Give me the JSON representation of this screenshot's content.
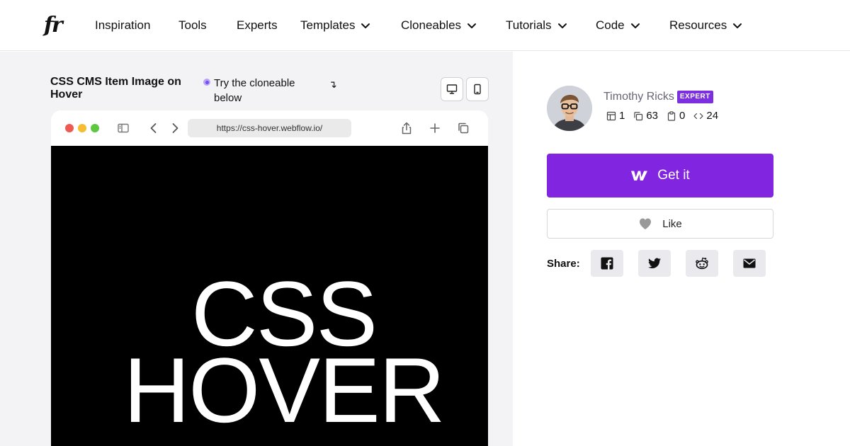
{
  "nav": {
    "logo": "fr",
    "items": [
      {
        "label": "Inspiration",
        "dropdown": false
      },
      {
        "label": "Tools",
        "dropdown": false
      },
      {
        "label": "Experts",
        "dropdown": false
      },
      {
        "label": "Templates",
        "dropdown": true
      },
      {
        "label": "Cloneables",
        "dropdown": true
      },
      {
        "label": "Tutorials",
        "dropdown": true
      },
      {
        "label": "Code",
        "dropdown": true
      },
      {
        "label": "Resources",
        "dropdown": true
      }
    ]
  },
  "preview": {
    "title": "CSS CMS Item Image on Hover",
    "hint": "Try the cloneable below",
    "hint_arrow": "↴",
    "url": "https://css-hover.webflow.io/",
    "hero_text": "CSS\nHOVER"
  },
  "author": {
    "name": "Timothy Ricks",
    "badge": "EXPERT",
    "stats": {
      "pages": "1",
      "clones": "63",
      "copies": "0",
      "embeds": "24"
    }
  },
  "actions": {
    "get_label": "Get it",
    "like_label": "Like",
    "share_label": "Share:"
  },
  "colors": {
    "accent": "#8125e0",
    "badge": "#7b2fe0",
    "left_bg": "#f3f3f6"
  },
  "icons": [
    "monitor-icon",
    "mobile-icon",
    "sidebar-icon",
    "chevron-left-icon",
    "chevron-right-icon",
    "share-icon",
    "plus-icon",
    "copy-icon",
    "webflow-icon",
    "heart-icon",
    "facebook-icon",
    "twitter-icon",
    "reddit-icon",
    "mail-icon"
  ]
}
